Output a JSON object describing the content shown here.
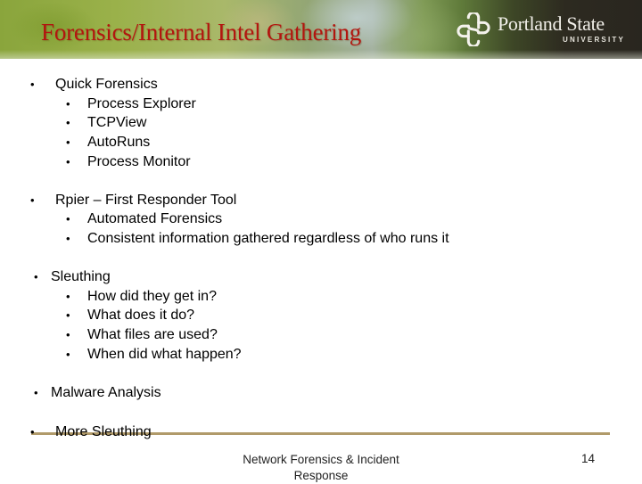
{
  "header": {
    "title": "Forensics/Internal Intel Gathering",
    "logo": {
      "icon": "psu-knot-icon",
      "name": "Portland State",
      "subtitle": "UNIVERSITY"
    },
    "title_color": "#b3150f"
  },
  "content": {
    "bullet_glyph": "•",
    "sections": [
      {
        "label": "Quick Forensics",
        "items": [
          "Process Explorer",
          "TCPView",
          "AutoRuns",
          "Process Monitor"
        ]
      },
      {
        "label": "Rpier – First Responder Tool",
        "items": [
          "Automated Forensics",
          "Consistent information gathered regardless of who runs it"
        ]
      },
      {
        "label": "Sleuthing",
        "items": [
          "How did they get in?",
          "What does it do?",
          "What files are used?",
          "When did what happen?"
        ]
      },
      {
        "label": "Malware Analysis",
        "items": []
      },
      {
        "label": "More Sleuthing",
        "items": []
      }
    ]
  },
  "footer": {
    "course_title": "Network Forensics & Incident Response",
    "page_number": "14",
    "divider_color": "#b09a6a"
  }
}
